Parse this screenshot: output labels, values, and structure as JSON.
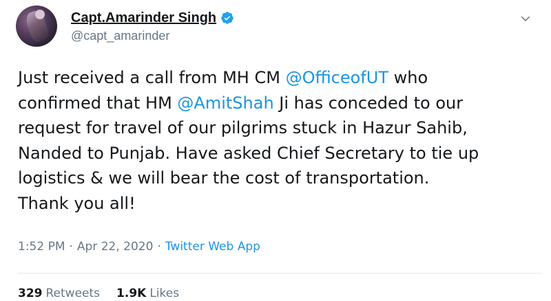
{
  "tweet": {
    "author": {
      "display_name": "Capt.Amarinder Singh",
      "handle": "@capt_amarinder",
      "verified": true
    },
    "text_segments": [
      {
        "type": "text",
        "value": "Just received a call from MH CM "
      },
      {
        "type": "mention",
        "value": "@OfficeofUT"
      },
      {
        "type": "text",
        "value": " who\nconfirmed that HM "
      },
      {
        "type": "mention",
        "value": "@AmitShah"
      },
      {
        "type": "text",
        "value": " Ji has conceded to our\nrequest for travel of our pilgrims stuck in Hazur Sahib,\nNanded to Punjab. Have asked Chief Secretary to tie up\nlogistics & we will bear the cost of transportation.\nThank you all!"
      }
    ],
    "time": "1:52 PM",
    "separator": "·",
    "date": "Apr 22, 2020",
    "source": "Twitter Web App",
    "stats": {
      "retweets_count": "329",
      "retweets_label": "Retweets",
      "likes_count": "1.9K",
      "likes_label": "Likes"
    }
  },
  "icons": {
    "verified": "verified-badge-icon",
    "caret": "chevron-down-icon"
  },
  "colors": {
    "link": "#1b95e0",
    "text": "#14171a",
    "muted": "#657786",
    "verified": "#1da1f2"
  }
}
